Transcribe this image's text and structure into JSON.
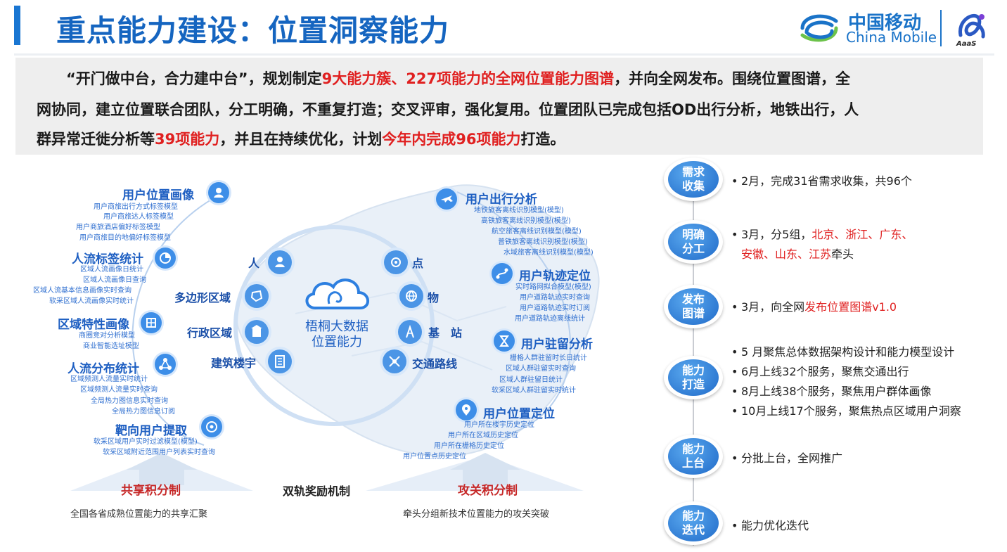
{
  "header": {
    "title": "重点能力建设：位置洞察能力",
    "logo_cn": "中国移动",
    "logo_en": "China Mobile",
    "aaas_label": "AaaS",
    "colors": {
      "title": "#1565c0",
      "accent": "#1976d2",
      "highlight": "#e02020"
    }
  },
  "intro": {
    "line1": {
      "a": "“开门做中台，合力建中台”，规划制定",
      "red": "9大能力簇、227项能力的全网位置能力图谱",
      "b": "，并向全网发布。围绕位置图谱，全"
    },
    "line2": "网协同，建立位置联合团队，分工明确，不重复打造；交叉评审，强化复用。位置团队已完成包括OD出行分析，地铁出行，人",
    "line3": {
      "a": "群异常迁徙分析等",
      "red1": "39项能力",
      "b": "，并且在持续优化，计划",
      "red2": "今年内完成96项能力",
      "c": "打造。"
    }
  },
  "diagram": {
    "left_categories": [
      {
        "name": "用户位置画像",
        "icon": "person-location-icon",
        "items": [
          "用户商旅出行方式标签模型",
          "用户商旅达人标签模型",
          "用户商旅酒店偏好标签模型",
          "用户商旅目的地偏好标签模型"
        ]
      },
      {
        "name": "人流标签统计",
        "icon": "pie-chart-icon",
        "items": [
          "区域人流画像日统计",
          "区域人流画像日查询",
          "区域人流基本信息画像实时查询",
          "软采区域人流画像实时统计"
        ]
      },
      {
        "name": "区域特性画像",
        "icon": "grid-icon",
        "items": [
          "商圈竞对分析模型",
          "商业智能选址模型"
        ]
      },
      {
        "name": "人流分布统计",
        "icon": "network-icon",
        "items": [
          "区域频测人流量实时统计",
          "区域频测人流量实时查询",
          "全局热力图信息实时查询",
          "全局热力图信息订阅"
        ]
      },
      {
        "name": "靶向用户提取",
        "icon": "target-icon",
        "items": [
          "软采区域用户实时过滤模型(模型)",
          "软采区域附近范围用户列表实时查询"
        ]
      }
    ],
    "right_categories": [
      {
        "name": "用户出行分析",
        "icon": "plane-icon",
        "items": [
          "地铁旅客离线识别模型(模型)",
          "高铁旅客离线识别模型(模型)",
          "航空旅客离线识别模型(模型)",
          "普铁旅客离线识别模型(模型)",
          "水域旅客离线识别模型(模型)"
        ]
      },
      {
        "name": "用户轨迹定位",
        "icon": "route-icon",
        "items": [
          "实时路网拟合模型(模型)",
          "用户道路轨迹实时查询",
          "用户道路轨迹实时订阅",
          "用户道路轨迹离线统计"
        ]
      },
      {
        "name": "用户驻留分析",
        "icon": "hourglass-icon",
        "items": [
          "栅格人群驻留时长日统计",
          "区域人群驻留实时查询",
          "区域人群驻留日统计",
          "软采区域人群驻留实时统计"
        ]
      },
      {
        "name": "用户位置定位",
        "icon": "location-pin-icon",
        "items": [
          "用户所在楼宇历史定位",
          "用户所在区域历史定位",
          "用户所在栅格历史定位",
          "用户位置点历史定位"
        ]
      }
    ],
    "ring_left": [
      {
        "label": "人",
        "icon": "person-icon"
      },
      {
        "label": "多边形区域",
        "icon": "polygon-icon"
      },
      {
        "label": "行政区域",
        "icon": "building-icon"
      },
      {
        "label": "建筑楼宇",
        "icon": "tower-icon"
      }
    ],
    "ring_right": [
      {
        "label": "点",
        "icon": "point-icon"
      },
      {
        "label": "物",
        "icon": "globe-icon"
      },
      {
        "label": "基　站",
        "icon": "base-station-icon"
      },
      {
        "label": "交通路线",
        "icon": "traffic-icon"
      }
    ],
    "center": {
      "line1": "梧桐大数据",
      "line2": "位置能力"
    },
    "footer": {
      "left_title": "共享积分制",
      "middle": "双轨奖励机制",
      "right_title": "攻关积分制",
      "left_caption": "全国各省成熟位置能力的共享汇聚",
      "right_caption": "牵头分组新技术位置能力的攻关突破"
    }
  },
  "timeline": [
    {
      "step": [
        "需求",
        "收集"
      ],
      "bullets": [
        [
          {
            "t": "2月，完成31省需求收集，共96个"
          }
        ]
      ]
    },
    {
      "step": [
        "明确",
        "分工"
      ],
      "bullets": [
        [
          {
            "t": "3月，分5组，"
          },
          {
            "t": "北京、浙江、广东、",
            "red": true
          }
        ],
        [
          {
            "t": "安徽、山东、江苏",
            "red": true,
            "indent": true
          },
          {
            "t": "牵头"
          }
        ]
      ]
    },
    {
      "step": [
        "发布",
        "图谱"
      ],
      "bullets": [
        [
          {
            "t": "3月，向全网"
          },
          {
            "t": "发布位置图谱v1.0",
            "red": true
          }
        ]
      ]
    },
    {
      "step": [
        "能力",
        "打造"
      ],
      "bullets": [
        [
          {
            "t": "5 月聚焦总体数据架构设计和能力模型设计"
          }
        ],
        [
          {
            "t": "6月上线32个服务，聚焦交通出行"
          }
        ],
        [
          {
            "t": "8月上线38个服务，聚焦用户群体画像"
          }
        ],
        [
          {
            "t": "10月上线17个服务，聚焦热点区域用户洞察"
          }
        ]
      ]
    },
    {
      "step": [
        "能力",
        "上台"
      ],
      "bullets": [
        [
          {
            "t": "分批上台，全网推广"
          }
        ]
      ]
    },
    {
      "step": [
        "能力",
        "迭代"
      ],
      "bullets": [
        [
          {
            "t": "能力优化迭代"
          }
        ]
      ]
    }
  ]
}
